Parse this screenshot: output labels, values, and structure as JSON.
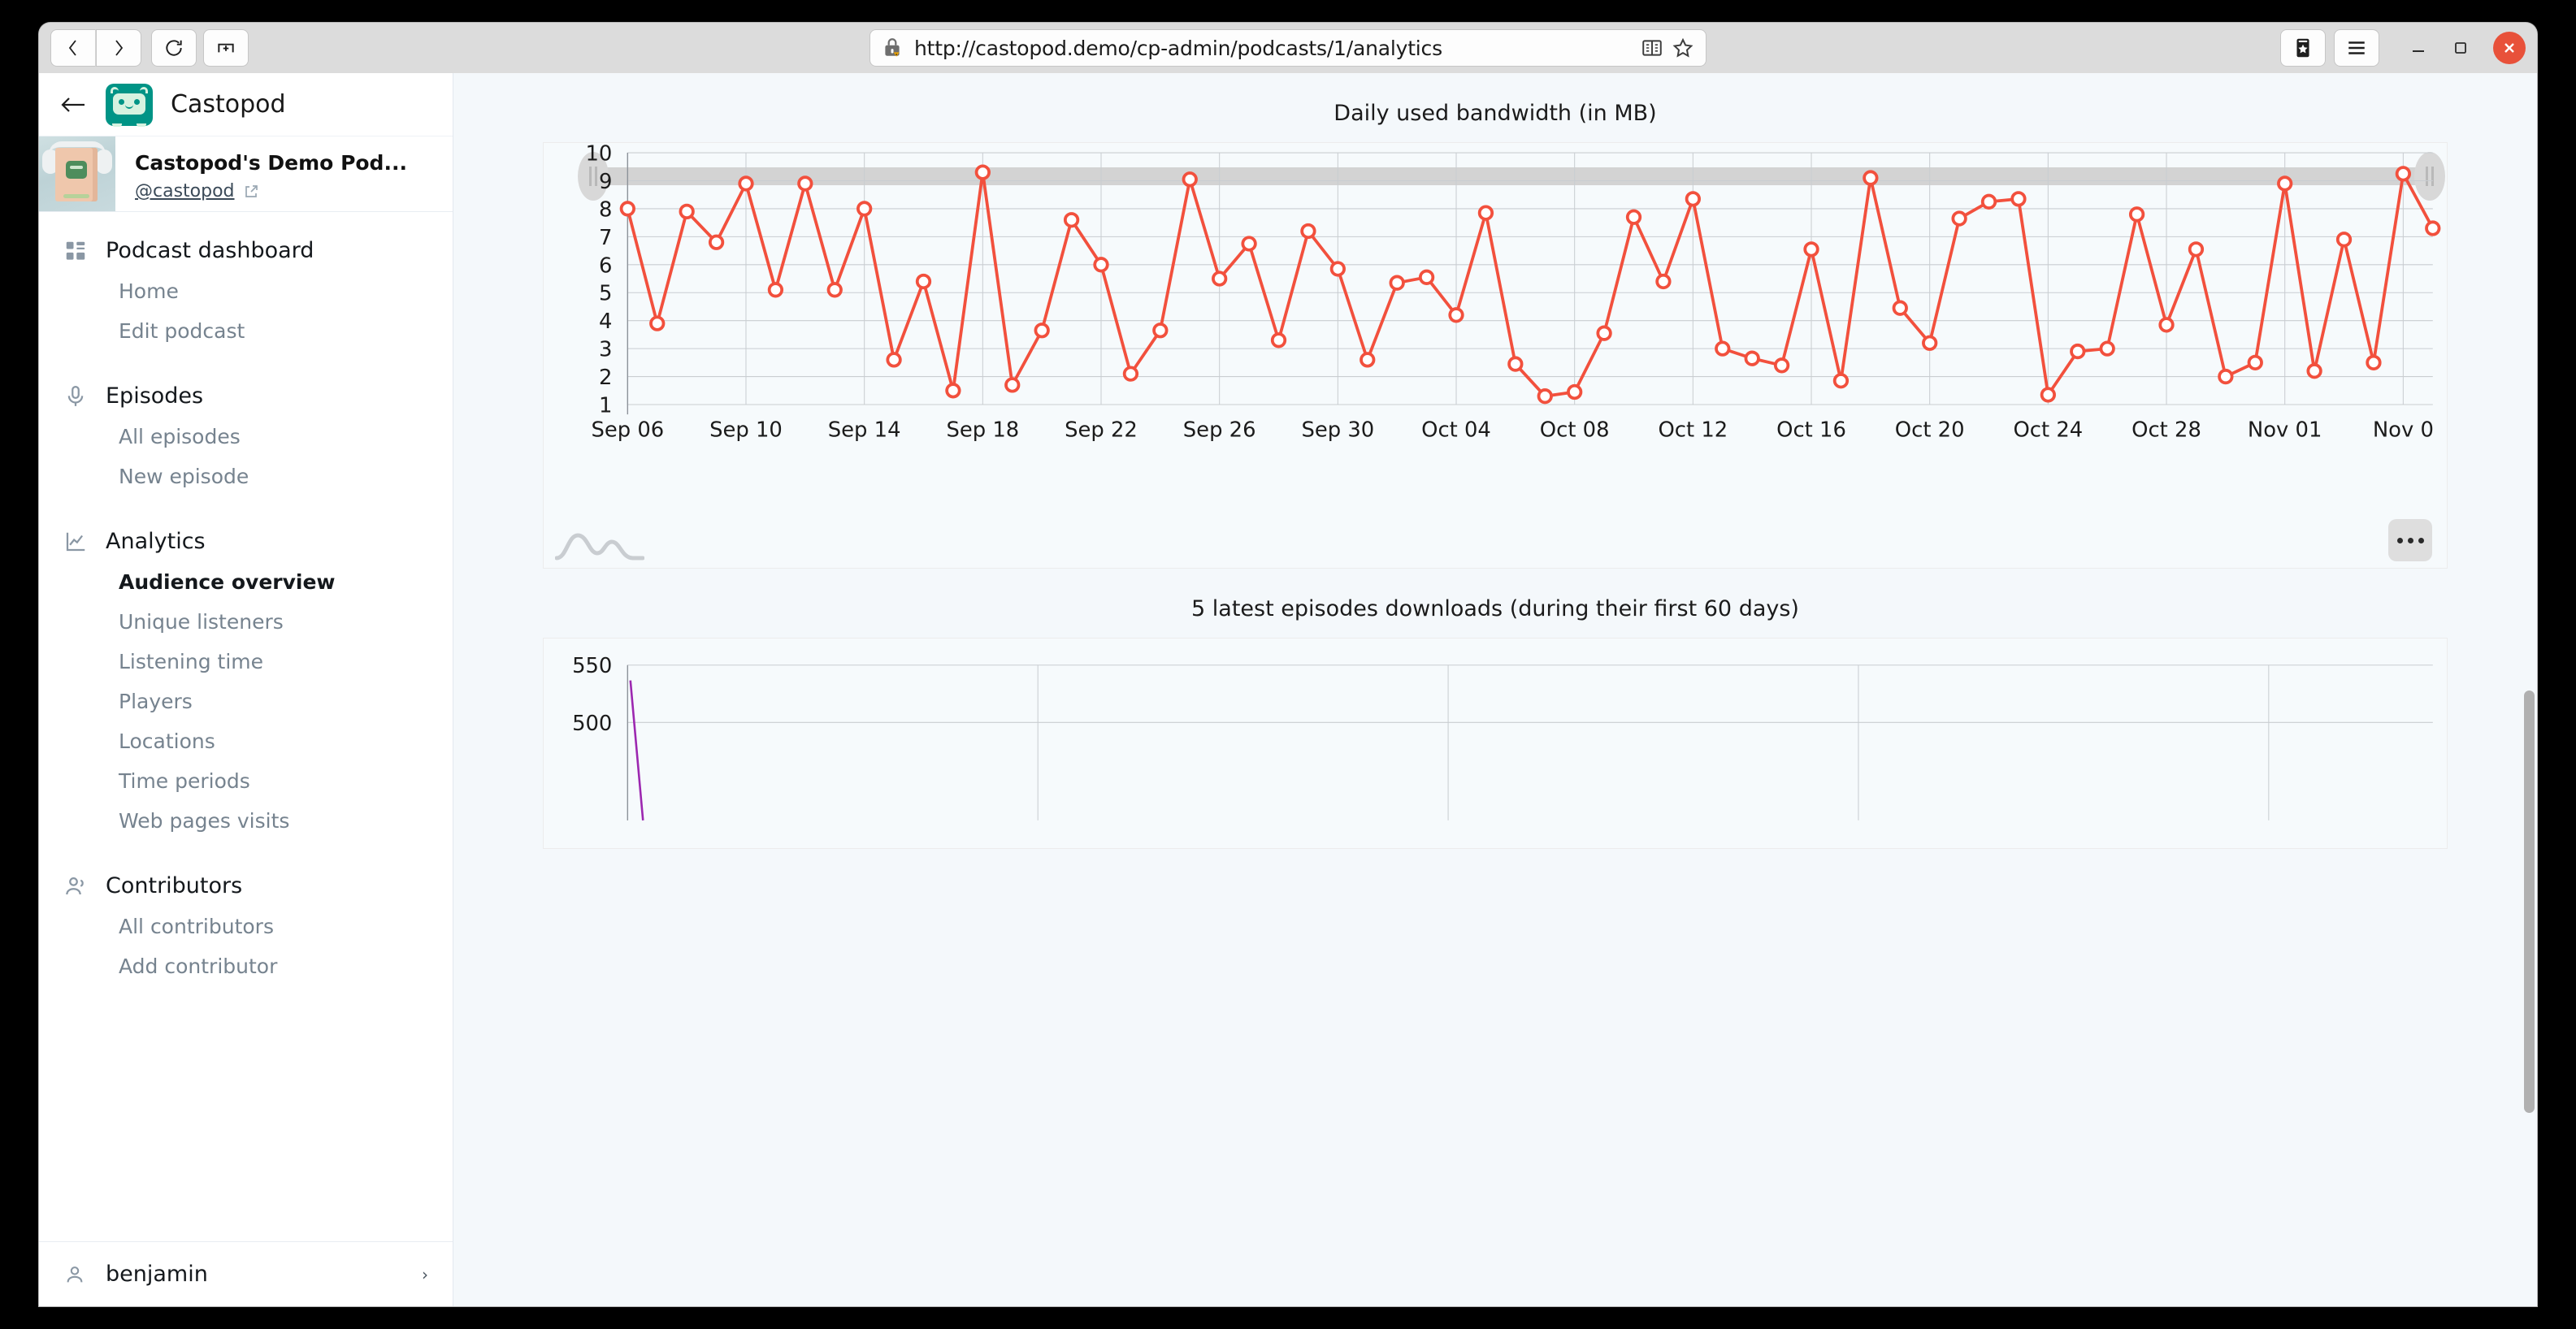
{
  "browser": {
    "url": "http://castopod.demo/cp-admin/podcasts/1/analytics",
    "back_label": "Back",
    "forward_label": "Forward",
    "reload_label": "Reload",
    "newtab_label": "New tab",
    "reader_label": "Reader view",
    "bookmark_label": "Bookmark this page",
    "library_label": "Bookmarks library",
    "menu_label": "Open application menu",
    "minimize_label": "Minimize",
    "maximize_label": "Maximize",
    "close_label": "Close"
  },
  "sidebar": {
    "back_label": "Back",
    "brand": "Castopod",
    "podcast": {
      "title": "Castopod's Demo Pod...",
      "handle": "@castopod"
    },
    "groups": [
      {
        "icon": "dashboard-icon",
        "label": "Podcast dashboard",
        "items": [
          {
            "label": "Home",
            "active": false
          },
          {
            "label": "Edit podcast",
            "active": false
          }
        ]
      },
      {
        "icon": "microphone-icon",
        "label": "Episodes",
        "items": [
          {
            "label": "All episodes",
            "active": false
          },
          {
            "label": "New episode",
            "active": false
          }
        ]
      },
      {
        "icon": "line-chart-icon",
        "label": "Analytics",
        "items": [
          {
            "label": "Audience overview",
            "active": true
          },
          {
            "label": "Unique listeners",
            "active": false
          },
          {
            "label": "Listening time",
            "active": false
          },
          {
            "label": "Players",
            "active": false
          },
          {
            "label": "Locations",
            "active": false
          },
          {
            "label": "Time periods",
            "active": false
          },
          {
            "label": "Web pages visits",
            "active": false
          }
        ]
      },
      {
        "icon": "users-icon",
        "label": "Contributors",
        "items": [
          {
            "label": "All contributors",
            "active": false
          },
          {
            "label": "Add contributor",
            "active": false
          }
        ]
      }
    ],
    "user": {
      "name": "benjamin",
      "chevron": "›"
    }
  },
  "colors": {
    "accent": "#009486",
    "series_red": "#f2503d",
    "series_purple": "#9c27b0",
    "page_bg": "#f4f8fb",
    "plot_bg": "#f6fafc",
    "grid": "#c9cdd1"
  },
  "chart_data": [
    {
      "type": "line",
      "title": "Daily used bandwidth (in MB)",
      "xlabel": "",
      "ylabel": "",
      "ylim": [
        1,
        10
      ],
      "yticks": [
        1,
        2,
        3,
        4,
        5,
        6,
        7,
        8,
        9,
        10
      ],
      "grid": true,
      "legend": "none",
      "marker": "circle-hollow",
      "color": "#f2503d",
      "xtick_labels": [
        "Sep 06",
        "Sep 10",
        "Sep 14",
        "Sep 18",
        "Sep 22",
        "Sep 26",
        "Sep 30",
        "Oct 04",
        "Oct 08",
        "Oct 12",
        "Oct 16",
        "Oct 20",
        "Oct 24",
        "Oct 28",
        "Nov 01",
        "Nov 0"
      ],
      "x": [
        "Sep 06",
        "Sep 07",
        "Sep 08",
        "Sep 09",
        "Sep 10",
        "Sep 11",
        "Sep 12",
        "Sep 13",
        "Sep 14",
        "Sep 15",
        "Sep 16",
        "Sep 17",
        "Sep 18",
        "Sep 19",
        "Sep 20",
        "Sep 21",
        "Sep 22",
        "Sep 23",
        "Sep 24",
        "Sep 25",
        "Sep 26",
        "Sep 27",
        "Sep 28",
        "Sep 29",
        "Sep 30",
        "Oct 01",
        "Oct 02",
        "Oct 03",
        "Oct 04",
        "Oct 05",
        "Oct 06",
        "Oct 07",
        "Oct 08",
        "Oct 09",
        "Oct 10",
        "Oct 11",
        "Oct 12",
        "Oct 13",
        "Oct 14",
        "Oct 15",
        "Oct 16",
        "Oct 17",
        "Oct 18",
        "Oct 19",
        "Oct 20",
        "Oct 21",
        "Oct 22",
        "Oct 23",
        "Oct 24",
        "Oct 25",
        "Oct 26",
        "Oct 27",
        "Oct 28",
        "Oct 29",
        "Oct 30",
        "Oct 31",
        "Nov 01",
        "Nov 02",
        "Nov 03",
        "Nov 04",
        "Nov 05"
      ],
      "values": [
        8.0,
        3.9,
        7.9,
        6.8,
        8.9,
        5.1,
        8.9,
        5.1,
        8.0,
        2.6,
        5.4,
        1.5,
        9.3,
        1.7,
        3.65,
        7.6,
        6.0,
        2.1,
        3.65,
        9.05,
        5.5,
        6.75,
        3.3,
        7.2,
        5.85,
        2.6,
        5.35,
        5.55,
        4.2,
        7.85,
        2.45,
        1.3,
        1.45,
        3.55,
        7.7,
        5.4,
        8.35,
        3.0,
        2.65,
        2.4,
        6.55,
        1.85,
        9.1,
        4.45,
        3.2,
        7.65,
        8.25,
        8.35,
        1.35,
        2.9,
        3.0,
        7.8,
        3.85,
        6.55,
        2.0,
        2.5,
        8.9,
        2.2,
        6.9,
        2.5,
        9.25,
        7.3
      ],
      "controls": {
        "range_slider": true,
        "menu_button": "...",
        "minimap": "sparkline"
      }
    },
    {
      "type": "line",
      "title": "5 latest episodes downloads (during their first 60 days)",
      "ylim": [
        500,
        550
      ],
      "yticks": [
        500,
        550
      ],
      "grid": true,
      "color": "#9c27b0",
      "values": [
        535
      ]
    }
  ]
}
